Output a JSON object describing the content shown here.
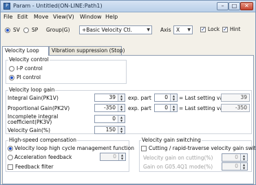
{
  "window": {
    "title": "Param - Untitled(ON-LINE:Path1)",
    "icon_glyph": "P"
  },
  "title_buttons": {
    "minimize": "–",
    "maximize": "□",
    "close": "✕"
  },
  "menu": [
    "File",
    "Edit",
    "Move",
    "View(V)",
    "Window",
    "Help"
  ],
  "toolbar": {
    "sv_label": "SV",
    "sp_label": "SP",
    "selected": "SV",
    "group_label": "Group(G)",
    "group_value": "+Basic Velocity Ctl.",
    "axis_label": "Axis",
    "axis_value": "X",
    "lock_label": "Lock",
    "lock_checked": true,
    "hint_label": "Hint",
    "hint_checked": true
  },
  "tabs": [
    "Velocity Loop",
    "Vibration suppression (Stop)"
  ],
  "active_tab": 0,
  "velocity_control": {
    "title": "Velocity control",
    "options": [
      "I-P control",
      "PI control"
    ],
    "selected": 1
  },
  "gain": {
    "title": "Velocity loop gain",
    "integral_label": "Integral Gain(PK1V)",
    "integral_value": "39",
    "integral_exp_label": "exp. part",
    "integral_exp": "0",
    "integral_last_label": "= Last setting value",
    "integral_last": "39",
    "prop_label": "Proportional Gain(PK2V)",
    "prop_value": "-350",
    "prop_exp_label": "exp. part",
    "prop_exp": "0",
    "prop_last_label": "= Last setting value",
    "prop_last": "-350",
    "incomplete_label_1": "Incomplete integral",
    "incomplete_label_2": "coefficient(PK3V)",
    "incomplete_value": "0",
    "velocity_gain_label": "Velocity Gain(%)",
    "velocity_gain_value": "150"
  },
  "hs_comp": {
    "title": "High-speed compensation",
    "option1": "Velocity loop high cycle management function",
    "option2": "Acceleration feedback",
    "accel_value": "0",
    "feedback_filter_label": "Feedback filter",
    "selected": 0
  },
  "vg_switch": {
    "title": "Velocity gain switching",
    "check_label": "Cutting / rapid-traverse velocity gain switching",
    "cutting_label": "Velocity gain on cutting(%)",
    "cutting_value": "0",
    "g05_label": "Gain on G05.4Q1 mode(%)",
    "g05_value": "0"
  }
}
